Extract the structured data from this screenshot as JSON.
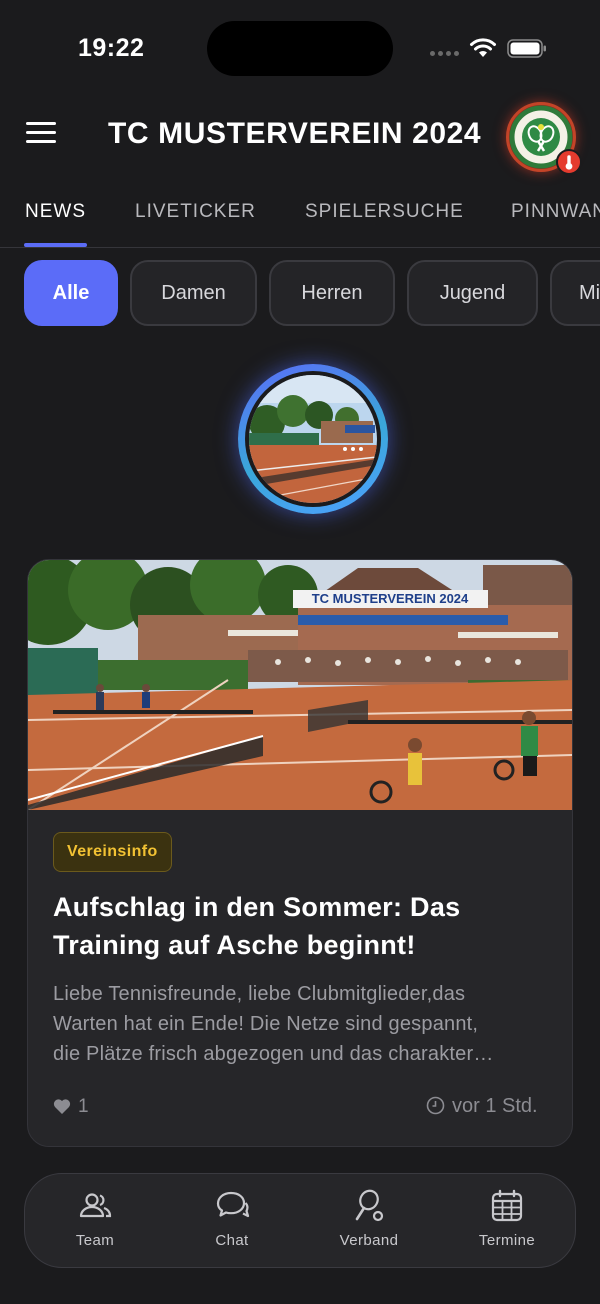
{
  "status_bar": {
    "time": "19:22"
  },
  "header": {
    "title": "TC MUSTERVEREIN 2024"
  },
  "tabs": [
    {
      "label": "NEWS",
      "active": true
    },
    {
      "label": "LIVETICKER",
      "active": false
    },
    {
      "label": "SPIELERSUCHE",
      "active": false
    },
    {
      "label": "PINNWAND",
      "active": false
    }
  ],
  "filters": [
    {
      "label": "Alle",
      "active": true
    },
    {
      "label": "Damen",
      "active": false
    },
    {
      "label": "Herren",
      "active": false
    },
    {
      "label": "Jugend",
      "active": false
    },
    {
      "label": "Mixed",
      "active": false
    }
  ],
  "news": {
    "image_banner_text": "TC MUSTERVEREIN 2024",
    "category": "Vereinsinfo",
    "title": "Aufschlag in den Sommer: Das Training auf Asche beginnt!",
    "excerpt_lines": [
      "Liebe Tennisfreunde, liebe Clubmitglieder,das",
      "Warten hat ein Ende! Die Netze sind gespannt,",
      "die Plätze frisch abgezogen und das charakter…"
    ],
    "likes": "1",
    "time": "vor 1 Std."
  },
  "bottom_nav": [
    {
      "label": "Team",
      "icon": "team-icon"
    },
    {
      "label": "Chat",
      "icon": "chat-icon"
    },
    {
      "label": "Verband",
      "icon": "verband-icon"
    },
    {
      "label": "Termine",
      "icon": "calendar-icon"
    }
  ],
  "colors": {
    "background": "#1b1b1d",
    "accent": "#5b6cf8",
    "badge_text": "#f2c233",
    "notification": "#e53b2e"
  }
}
